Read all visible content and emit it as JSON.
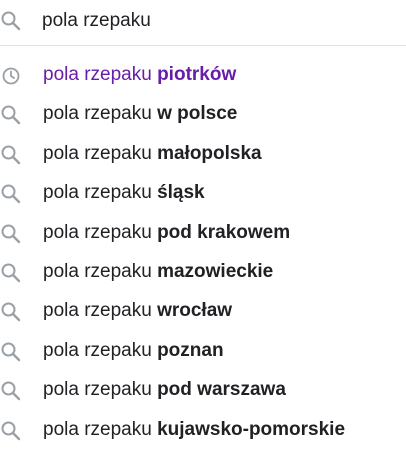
{
  "search": {
    "value": "pola rzepaku",
    "icon": "search-icon"
  },
  "colors": {
    "history_text": "#681da8",
    "text": "#202124",
    "icon": "#9aa0a6",
    "divider": "#dfe1e5"
  },
  "suggestions": [
    {
      "prefix": "pola rzepaku",
      "completion": "piotrków",
      "icon": "history-clock-icon",
      "visited": true
    },
    {
      "prefix": "pola rzepaku",
      "completion": "w polsce",
      "icon": "search-icon",
      "visited": false
    },
    {
      "prefix": "pola rzepaku",
      "completion": "małopolska",
      "icon": "search-icon",
      "visited": false
    },
    {
      "prefix": "pola rzepaku",
      "completion": "śląsk",
      "icon": "search-icon",
      "visited": false
    },
    {
      "prefix": "pola rzepaku",
      "completion": "pod krakowem",
      "icon": "search-icon",
      "visited": false
    },
    {
      "prefix": "pola rzepaku",
      "completion": "mazowieckie",
      "icon": "search-icon",
      "visited": false
    },
    {
      "prefix": "pola rzepaku",
      "completion": "wrocław",
      "icon": "search-icon",
      "visited": false
    },
    {
      "prefix": "pola rzepaku",
      "completion": "poznan",
      "icon": "search-icon",
      "visited": false
    },
    {
      "prefix": "pola rzepaku",
      "completion": "pod warszawa",
      "icon": "search-icon",
      "visited": false
    },
    {
      "prefix": "pola rzepaku",
      "completion": "kujawsko-pomorskie",
      "icon": "search-icon",
      "visited": false
    }
  ]
}
